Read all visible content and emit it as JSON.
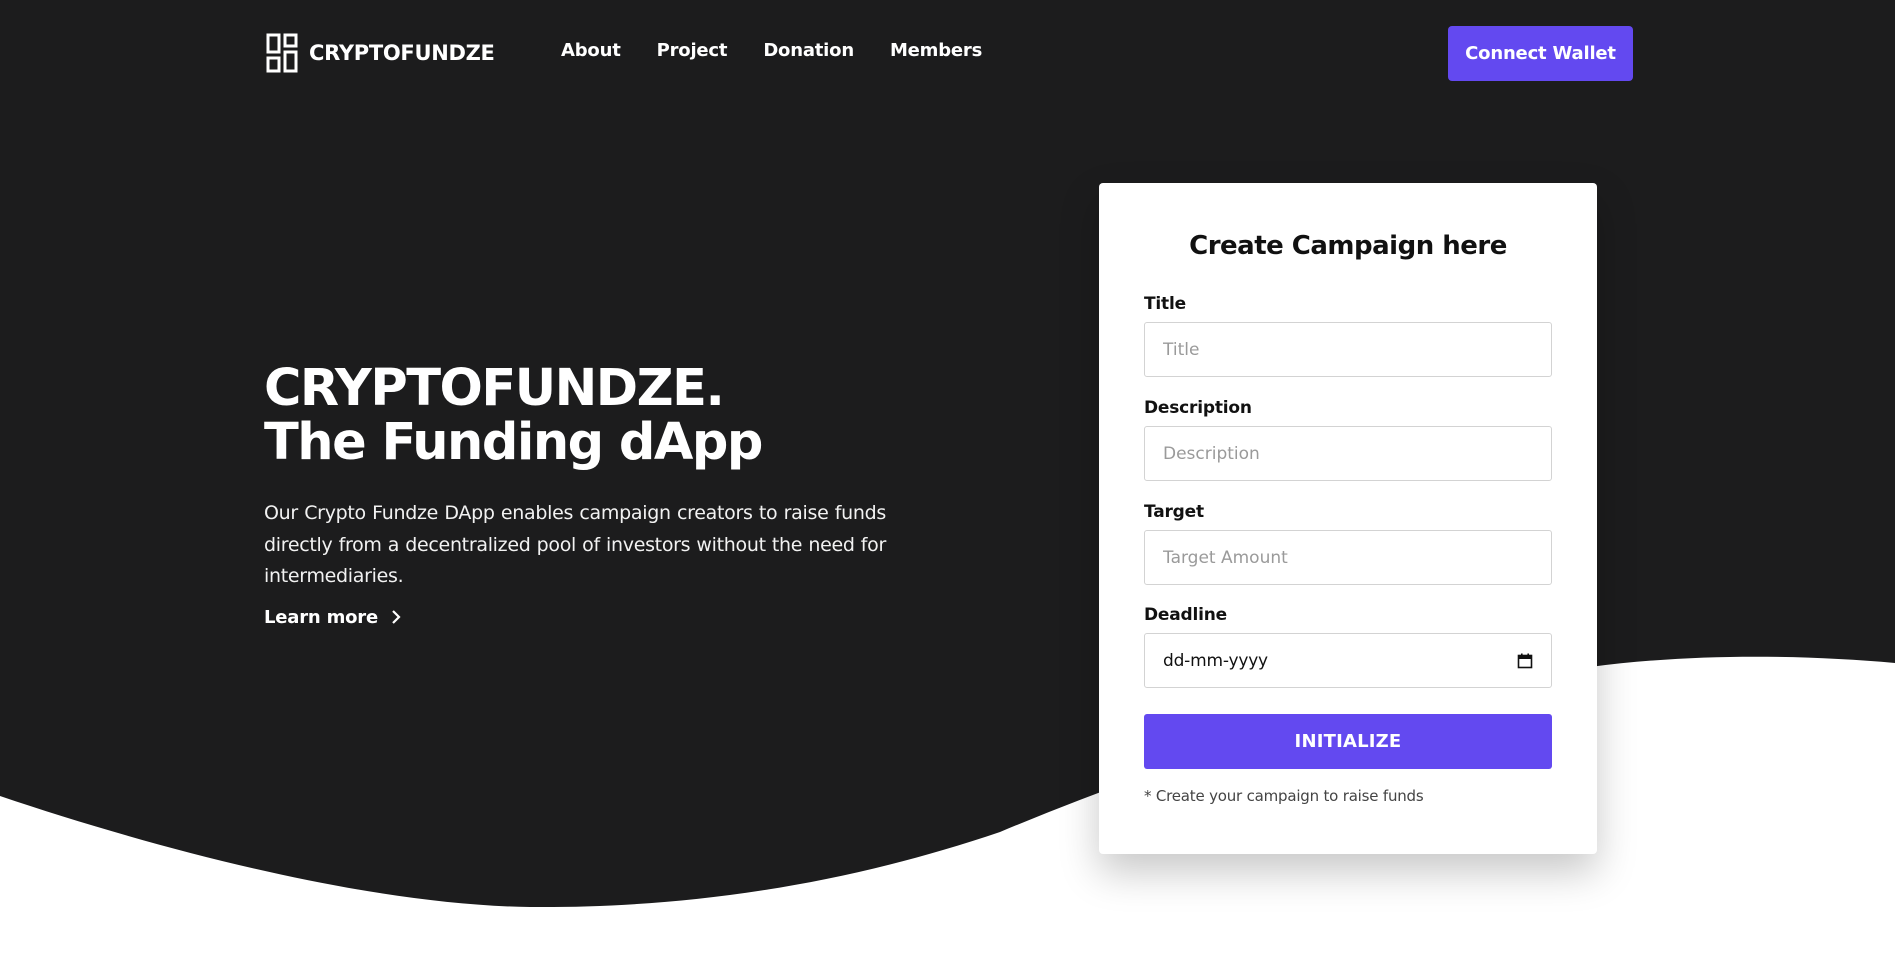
{
  "brand": {
    "name": "CRYPTOFUNDZE",
    "logo_icon": "grid-logo-icon"
  },
  "nav": {
    "items": [
      "About",
      "Project",
      "Donation",
      "Members"
    ]
  },
  "header": {
    "connect_label": "Connect Wallet"
  },
  "hero": {
    "title_line1": "CRYPTOFUNDZE.",
    "title_line2": "The Funding dApp",
    "description": "Our Crypto Fundze DApp enables campaign creators to raise funds directly from a decentralized pool of investors without the need for intermediaries.",
    "learn_more": "Learn more",
    "learn_more_icon": "chevron-right-icon"
  },
  "form": {
    "title": "Create Campaign here",
    "title_label": "Title",
    "title_placeholder": "Title",
    "description_label": "Description",
    "description_placeholder": "Description",
    "target_label": "Target",
    "target_placeholder": "Target Amount",
    "deadline_label": "Deadline",
    "deadline_value": "dd-mm-yyyy",
    "deadline_icon": "calendar-icon",
    "submit_label": "INITIALIZE",
    "hint": "* Create your campaign to raise funds"
  },
  "colors": {
    "background_dark": "#1c1c1d",
    "accent": "#6349f0",
    "page_light": "#ffffff"
  }
}
